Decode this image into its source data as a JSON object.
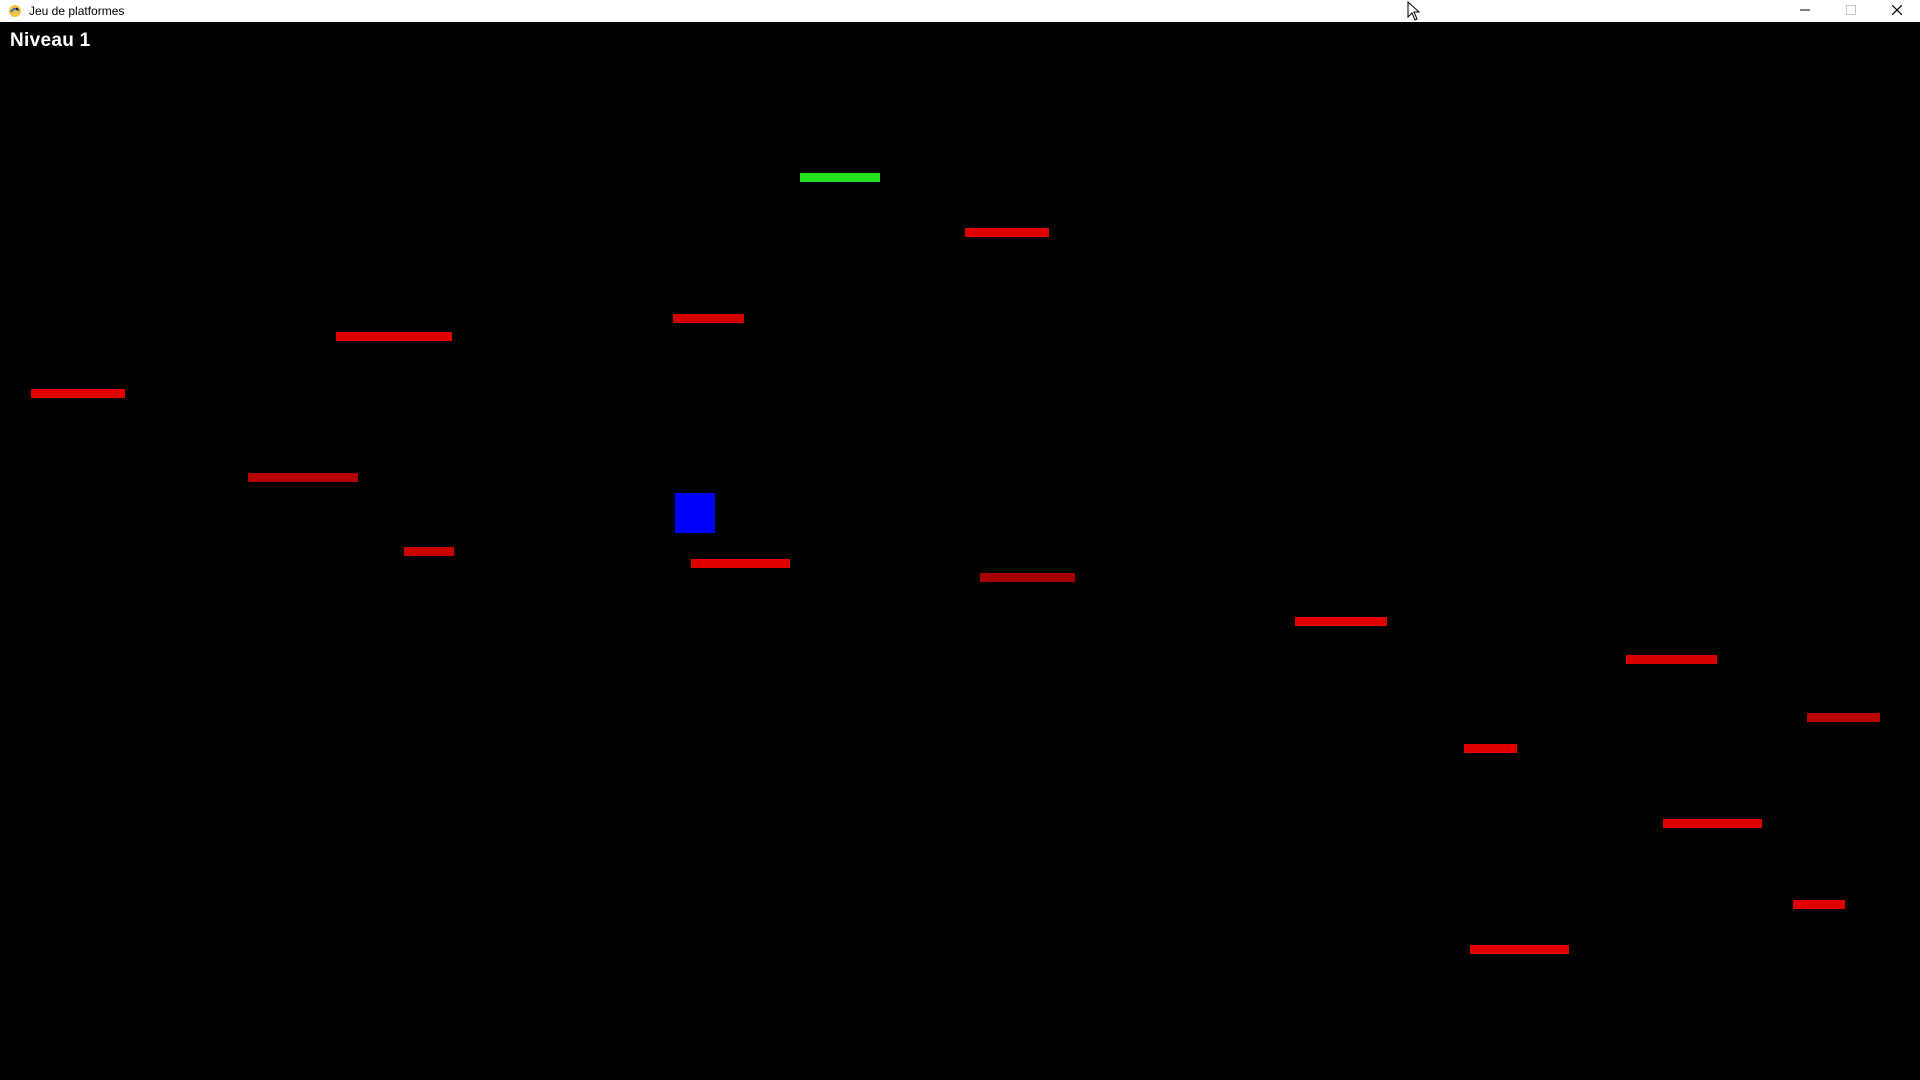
{
  "window": {
    "title": "Jeu de platformes",
    "app_icon": "pygame-snake-icon",
    "controls": {
      "minimize_icon": "minimize-icon",
      "maximize_icon": "maximize-icon",
      "close_icon": "close-icon"
    }
  },
  "hud": {
    "level_label": "Niveau 1"
  },
  "colors": {
    "background": "#000000",
    "platform_red": "#e00000",
    "platform_dark_red": "#b00000",
    "goal_green": "#22e01c",
    "player_blue": "#0000ff"
  },
  "entities": {
    "player": {
      "color": "#0000ff"
    },
    "goal_platform": {
      "color": "#22e01c"
    },
    "platforms": [
      {
        "color": "#e00000"
      },
      {
        "color": "#e00000"
      },
      {
        "color": "#d40000"
      },
      {
        "color": "#e00000"
      },
      {
        "color": "#b40000"
      },
      {
        "color": "#c80000"
      },
      {
        "color": "#e00000"
      },
      {
        "color": "#a80000"
      },
      {
        "color": "#e00000"
      },
      {
        "color": "#d80000"
      },
      {
        "color": "#b80000"
      },
      {
        "color": "#e00000"
      },
      {
        "color": "#e00000"
      },
      {
        "color": "#e00000"
      },
      {
        "color": "#e00000"
      },
      {
        "color": "#e00000"
      }
    ]
  }
}
